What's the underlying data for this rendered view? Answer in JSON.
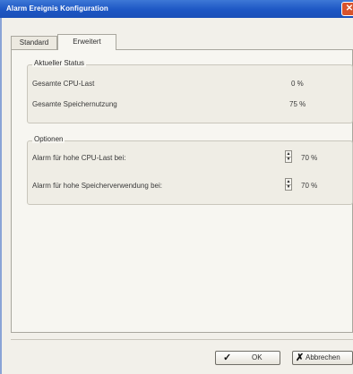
{
  "window": {
    "title": "Alarm Ereignis Konfiguration",
    "close_icon": "close-icon"
  },
  "tabs": [
    {
      "label": "Standard",
      "selected": false
    },
    {
      "label": "Erweitert",
      "selected": true
    }
  ],
  "status": {
    "legend": "Aktueller Status",
    "rows": [
      {
        "label": "Gesamte CPU-Last",
        "value": "0 %"
      },
      {
        "label": "Gesamte Speichernutzung",
        "value": "75 %"
      }
    ]
  },
  "options": {
    "legend": "Optionen",
    "rows": [
      {
        "label": "Alarm für hohe CPU-Last bei:",
        "value": "70 %"
      },
      {
        "label": "Alarm für hohe Speicherverwendung bei:",
        "value": "70 %"
      }
    ]
  },
  "buttons": {
    "ok": {
      "label": "OK",
      "icon": "checkmark-icon"
    },
    "cancel": {
      "label": "Abbrechen",
      "icon": "x-icon"
    }
  },
  "colors": {
    "titlebar": "#1d56c4",
    "close_button": "#d9532c"
  }
}
